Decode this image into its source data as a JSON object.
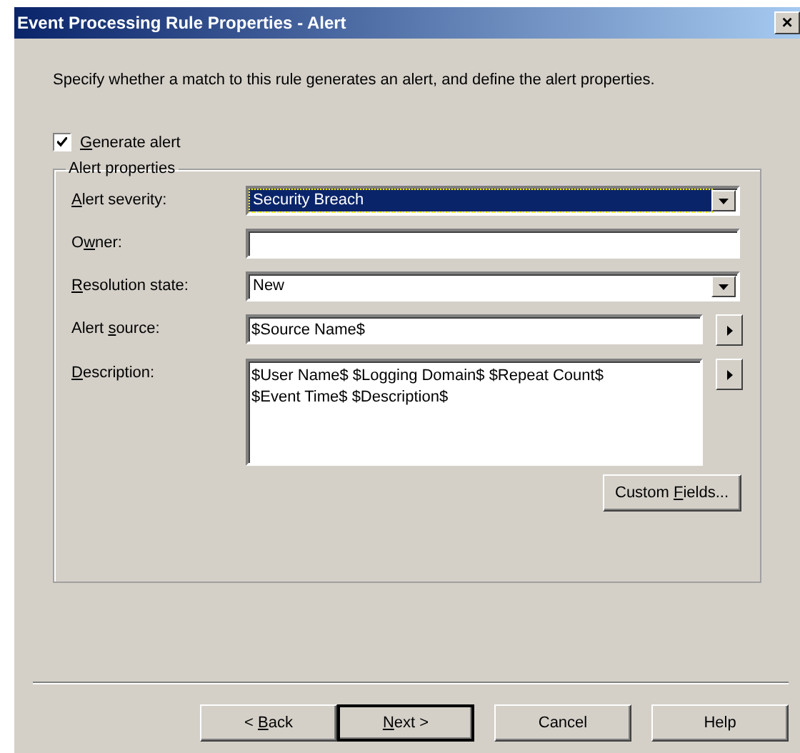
{
  "window": {
    "title": "Event Processing Rule Properties - Alert",
    "close_glyph": "×"
  },
  "intro": "Specify whether a match to this rule generates an alert, and define the alert properties.",
  "generate_alert": {
    "label": {
      "key": "G",
      "post": "enerate alert"
    },
    "checked": true
  },
  "group": {
    "title": "Alert properties",
    "fields": [
      {
        "kind": "combo",
        "label": {
          "key": "A",
          "post": "lert severity:"
        },
        "value": "Security Breach",
        "focused": true
      },
      {
        "kind": "text",
        "label": {
          "pre": "O",
          "key": "w",
          "post": "ner:"
        }
      },
      {
        "kind": "combo",
        "label": {
          "key": "R",
          "post": "esolution state:"
        },
        "value": "New",
        "focused": false
      },
      {
        "kind": "text_arrow",
        "label": {
          "pre": "Alert ",
          "key": "s",
          "post": "ource:"
        },
        "value": "$Source Name$"
      },
      {
        "kind": "multiline_arrow",
        "label": {
          "key": "D",
          "post": "escription:"
        },
        "value": "$User Name$ $Logging Domain$ $Repeat Count$ $Event Time$ $Description$"
      }
    ],
    "custom_button": {
      "pre": "Custom ",
      "key": "F",
      "post": "ields..."
    }
  },
  "buttons": [
    {
      "label": {
        "pre": "< ",
        "key": "B",
        "post": "ack"
      },
      "default": false
    },
    {
      "label": {
        "key": "N",
        "post": "ext >"
      },
      "default": true
    },
    {
      "label": {
        "pre": "Cancel"
      },
      "default": false
    },
    {
      "label": {
        "pre": "Help"
      },
      "default": false
    }
  ]
}
